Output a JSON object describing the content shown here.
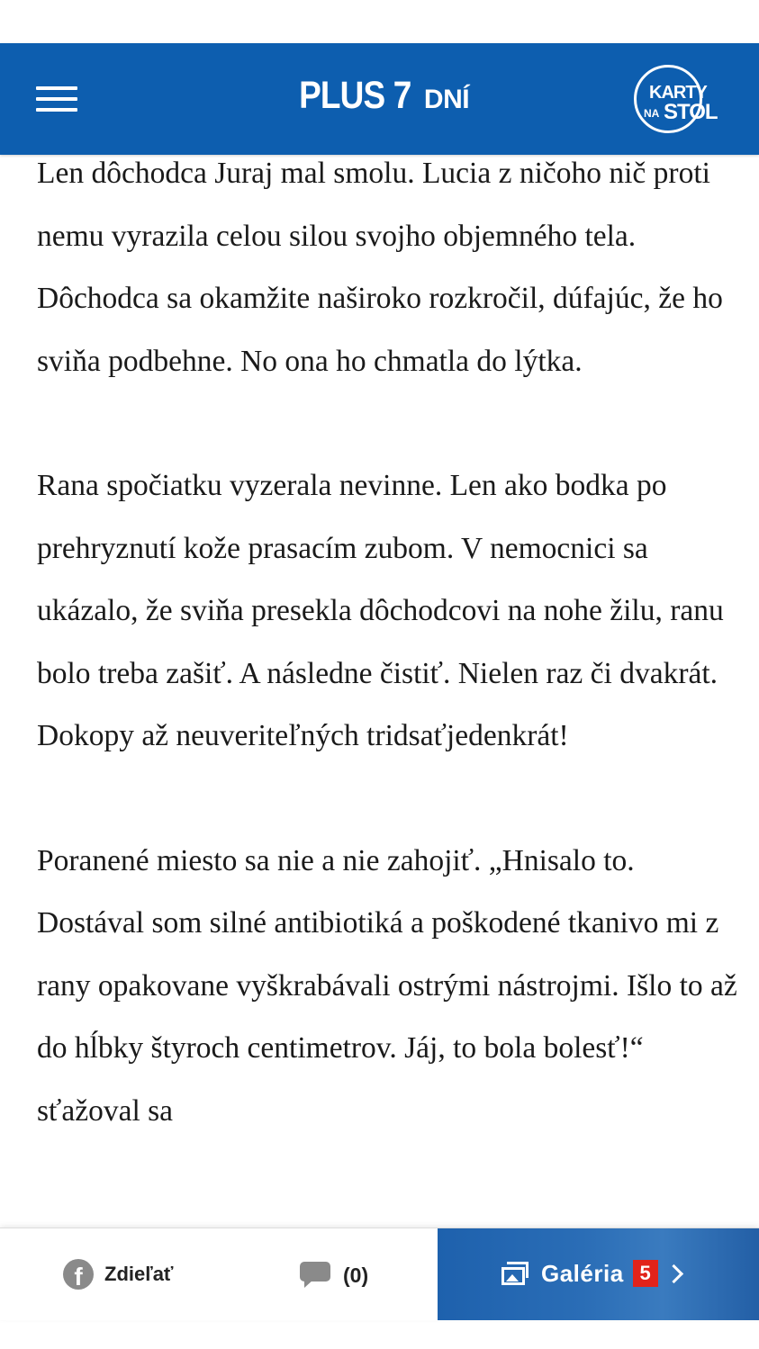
{
  "header": {
    "brand_main": "PLUS 7",
    "brand_sub": "DNÍ",
    "partner_logo_top": "KARTY",
    "partner_logo_small": "NA",
    "partner_logo_bottom": "STOL",
    "menu_icon": "hamburger-menu-icon",
    "bg_color": "#0d5eaf"
  },
  "article": {
    "paragraphs": [
      "Len dôchodca Juraj mal smolu. Lucia z ničoho nič proti nemu vyrazila celou silou svojho objemného tela. Dôchodca sa okamžite naširoko rozkročil, dúfajúc, že ho sviňa podbehne. No ona ho chmatla do lýtka.",
      "Rana spočiatku vyzerala nevinne. Len ako bodka po prehryznutí kože prasacím zubom. V nemocnici sa ukázalo, že sviňa presekla dôchodcovi na nohe žilu, ranu bolo treba zašiť. A následne čistiť. Nielen raz či dvakrát. Dokopy až neuveriteľných tridsaťjedenkrát!",
      "Poranené miesto sa nie a nie zahojiť. „Hnisalo to. Dostával som silné antibiotiká a poškodené tkanivo mi z rany opakovane vyškrabávali ostrými nástrojmi. Išlo to až do hĺbky štyroch centimetrov. Jáj, to bola bolesť!“ sťažoval sa"
    ]
  },
  "bottom_bar": {
    "share_label": "Zdieľať",
    "share_icon": "facebook-icon",
    "comments_label": "(0)",
    "comments_icon": "comment-icon",
    "gallery_label": "Galéria",
    "gallery_count": "5",
    "gallery_icon": "gallery-icon",
    "gallery_bg": "#2a6db6",
    "badge_color": "#e2231a"
  }
}
